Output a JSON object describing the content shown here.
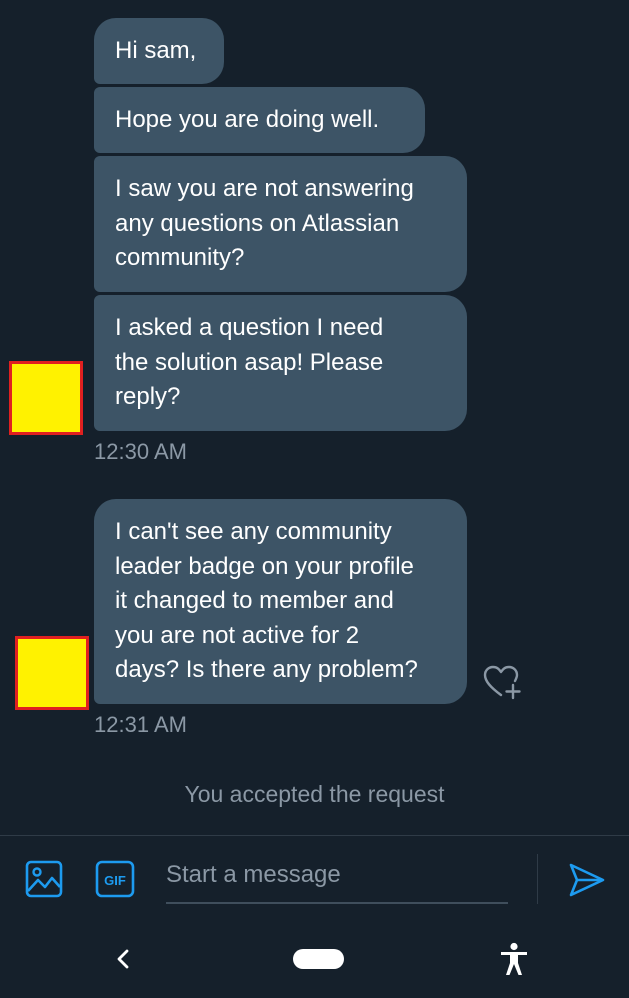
{
  "messages": [
    {
      "text": "Hi sam,"
    },
    {
      "text": "Hope you are doing well."
    },
    {
      "text": "I saw you are not answering\nany questions on Atlassian\ncommunity?"
    },
    {
      "text": "I asked a question I need\nthe solution asap! Please\nreply?"
    },
    {
      "text": "I can't see any community\nleader badge on your profile\nit changed to  member and\nyou are not active for 2\ndays? Is there any problem?"
    }
  ],
  "timestamps": [
    "12:30 AM",
    "12:31 AM"
  ],
  "notice": "You accepted the request",
  "composer": {
    "placeholder": "Start a message",
    "value": "",
    "gif_label": "GIF"
  },
  "icons": {
    "image": "image-icon",
    "gif": "gif-icon",
    "send": "send-icon",
    "heart": "heart-plus-icon",
    "back": "back-chevron-icon",
    "home": "home-pill-icon",
    "accessibility": "accessibility-icon"
  },
  "colors": {
    "background": "#15202b",
    "bubble": "#3d5466",
    "accent": "#1d9bf0",
    "muted_text": "#8b98a5",
    "avatar_fill": "#fff200",
    "avatar_border": "#e02020"
  }
}
